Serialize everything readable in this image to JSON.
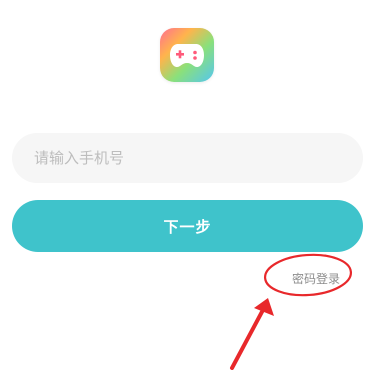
{
  "app_icon": {
    "name": "gamepad-icon",
    "colors": [
      "#ff6f91",
      "#ffb44c",
      "#8be07a",
      "#54c6f0"
    ]
  },
  "login_form": {
    "phone_placeholder": "请输入手机号",
    "phone_value": "",
    "next_button_label": "下一步",
    "password_login_link": "密码登录"
  },
  "theme": {
    "accent": "#3fc3cb",
    "annotation": "#e8282b"
  }
}
